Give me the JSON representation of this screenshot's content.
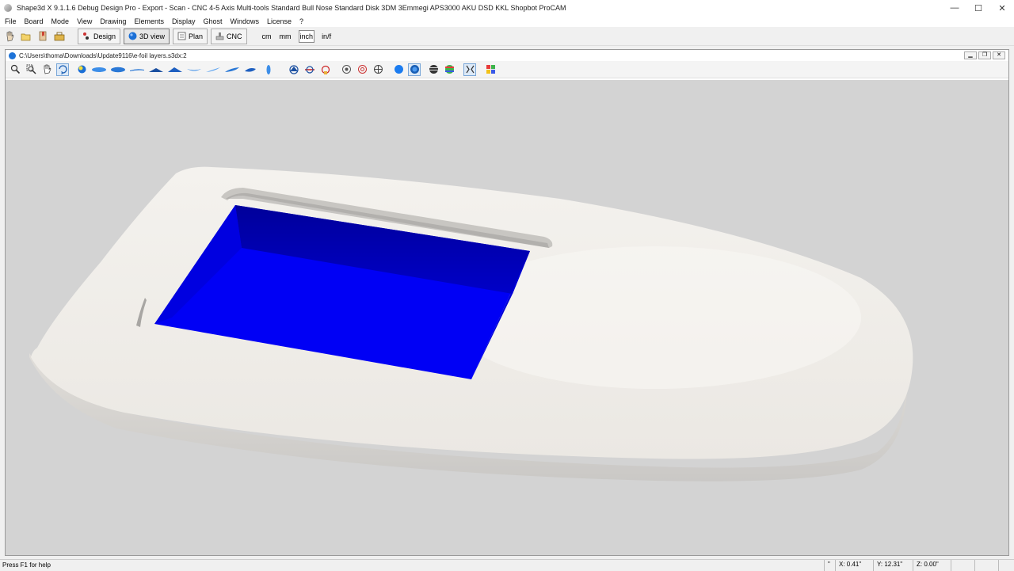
{
  "window": {
    "title": "Shape3d X 9.1.1.6 Debug Design Pro - Export - Scan - CNC 4-5 Axis Multi-tools  Standard Bull Nose Standard Disk 3DM 3Emmegi APS3000 AKU DSD KKL Shopbot ProCAM",
    "minimize": "—",
    "maximize": "☐",
    "close": "✕"
  },
  "menu": [
    "File",
    "Board",
    "Mode",
    "View",
    "Drawing",
    "Elements",
    "Display",
    "Ghost",
    "Windows",
    "License",
    "?"
  ],
  "modes": [
    {
      "label": "Design",
      "active": false
    },
    {
      "label": "3D view",
      "active": true
    },
    {
      "label": "Plan",
      "active": false
    },
    {
      "label": "CNC",
      "active": false
    }
  ],
  "units": [
    {
      "label": "cm",
      "active": false
    },
    {
      "label": "mm",
      "active": false
    },
    {
      "label": "inch",
      "active": true
    },
    {
      "label": "in/f",
      "active": false
    }
  ],
  "document": {
    "path": "C:\\Users\\thoma\\Downloads\\Update9116\\e-foil layers.s3dx:2"
  },
  "viewport": {
    "background_color": "#d3d3d3",
    "board_color": "#f2f0ec",
    "box_color": "#0000f5"
  },
  "status": {
    "help": "Press F1 for help",
    "marker": "\"",
    "x": "X: 0.41\"",
    "y": "Y: 12.31\"",
    "z": "Z: 0.00\""
  }
}
